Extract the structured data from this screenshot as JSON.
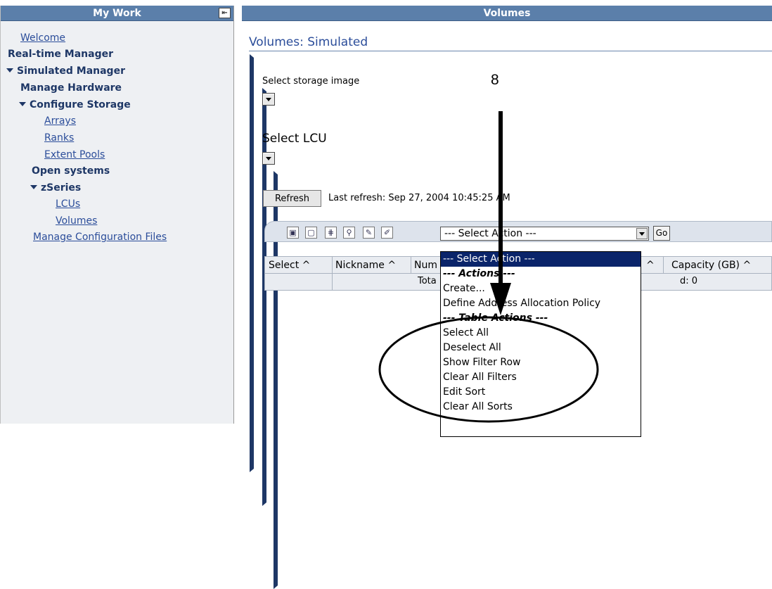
{
  "left_panel": {
    "title": "My Work",
    "nav": [
      {
        "label": "Welcome",
        "type": "link"
      },
      {
        "label": "Real-time Manager",
        "type": "collapsed"
      },
      {
        "label": "Simulated Manager",
        "type": "expanded"
      },
      {
        "label": "Manage Hardware",
        "type": "collapsed"
      },
      {
        "label": "Configure Storage",
        "type": "expanded"
      },
      {
        "label": "Arrays",
        "type": "link"
      },
      {
        "label": "Ranks",
        "type": "link"
      },
      {
        "label": "Extent Pools",
        "type": "link"
      },
      {
        "label": "Open systems",
        "type": "collapsed"
      },
      {
        "label": "zSeries",
        "type": "expanded"
      },
      {
        "label": "LCUs",
        "type": "link"
      },
      {
        "label": "Volumes",
        "type": "link"
      },
      {
        "label": "Manage Configuration Files",
        "type": "link"
      }
    ]
  },
  "main": {
    "header": "Volumes",
    "page_title": "Volumes: Simulated",
    "select_storage_label": "Select storage image",
    "select_lcu_label": "Select LCU",
    "refresh_label": "Refresh",
    "last_refresh": "Last refresh: Sep 27, 2004 10:45:25 AM",
    "action_select_value": "--- Select Action ---",
    "go_label": "Go",
    "columns": [
      "Select ^",
      "Nickname ^",
      "Num",
      "^",
      "Capacity (GB) ^"
    ],
    "row_text_left": "Tota",
    "row_text_right": "d: 0"
  },
  "dropdown": {
    "items": [
      {
        "label": "--- Select Action ---",
        "style": "selected"
      },
      {
        "label": "--- Actions ---",
        "style": "header"
      },
      {
        "label": "Create...",
        "style": "normal"
      },
      {
        "label": "Define Address Allocation Policy",
        "style": "normal"
      },
      {
        "label": "--- Table Actions ---",
        "style": "header"
      },
      {
        "label": "Select All",
        "style": "normal"
      },
      {
        "label": "Deselect All",
        "style": "normal"
      },
      {
        "label": "Show Filter Row",
        "style": "normal"
      },
      {
        "label": "Clear All Filters",
        "style": "normal"
      },
      {
        "label": "Edit Sort",
        "style": "normal"
      },
      {
        "label": "Clear All Sorts",
        "style": "normal"
      }
    ]
  },
  "annotation": {
    "callout_number": "8"
  },
  "colors": {
    "header_bg": "#5b7faa",
    "link": "#2b4d9a",
    "dropdown_selected": "#0a246a"
  }
}
